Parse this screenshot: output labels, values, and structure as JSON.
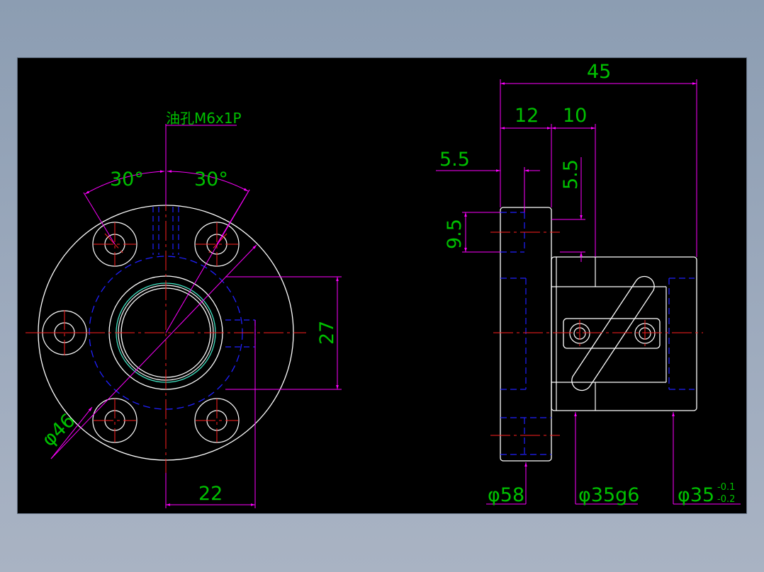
{
  "colors": {
    "background_gray": "#8c9db2",
    "drawing_area": "#000000",
    "outline": "#ffffff",
    "center_line": "#ff2020",
    "hidden_line": "#2020ff",
    "dimension_line": "#ff00ff",
    "dimension_text": "#00c000",
    "thread_line": "#40e0c0"
  },
  "front_view": {
    "oil_hole_label": "油孔M6x1P",
    "angle_left": "30°",
    "angle_right": "30°",
    "dim_height": "27",
    "dim_width": "22",
    "dim_diameter": "φ46"
  },
  "side_view": {
    "dim_overall": "45",
    "dim_flange": "12",
    "dim_step": "10",
    "dim_oil_offset_h": "5.5",
    "dim_oil_offset_v": "5.5",
    "dim_oil_height": "9.5",
    "dim_flange_dia": "φ58",
    "dim_body_dia": "φ35g6",
    "dim_tol_dia": "φ35",
    "tol_upper": "-0.1",
    "tol_lower": "-0.2"
  }
}
